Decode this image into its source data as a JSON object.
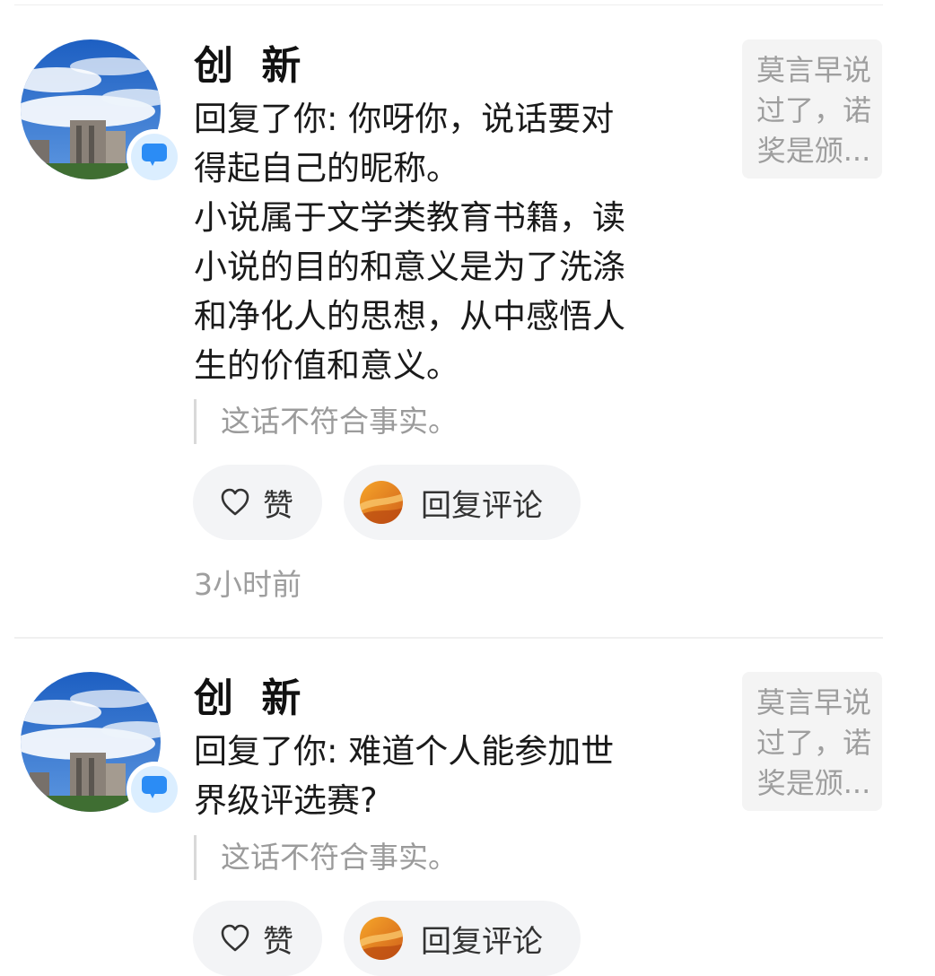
{
  "colors": {
    "accent": "#2b8cf5",
    "badge_bg": "#dbeeff",
    "pill_bg": "#f3f4f6",
    "muted_text": "#9e9e9e"
  },
  "notifications": [
    {
      "user_name": "创 新",
      "reply_lines": [
        "回复了你: 你呀你，说话要对",
        "得起自己的昵称。",
        "小说属于文学类教育书籍，读",
        "小说的目的和意义是为了洗涤",
        "和净化人的思想，从中感悟人",
        "生的价值和意义。"
      ],
      "quote": "这话不符合事实。",
      "like_label": "赞",
      "reply_label": "回复评论",
      "time": "3小时前",
      "origin_lines": [
        "莫言早说",
        "过了，诺",
        "奖是颁..."
      ],
      "badge_icon": "message-icon",
      "like_icon": "heart-outline-icon"
    },
    {
      "user_name": "创 新",
      "reply_lines": [
        "回复了你: 难道个人能参加世",
        "界级评选赛?"
      ],
      "quote": "这话不符合事实。",
      "like_label": "赞",
      "reply_label": "回复评论",
      "origin_lines": [
        "莫言早说",
        "过了，诺",
        "奖是颁..."
      ],
      "badge_icon": "message-icon",
      "like_icon": "heart-outline-icon"
    }
  ]
}
